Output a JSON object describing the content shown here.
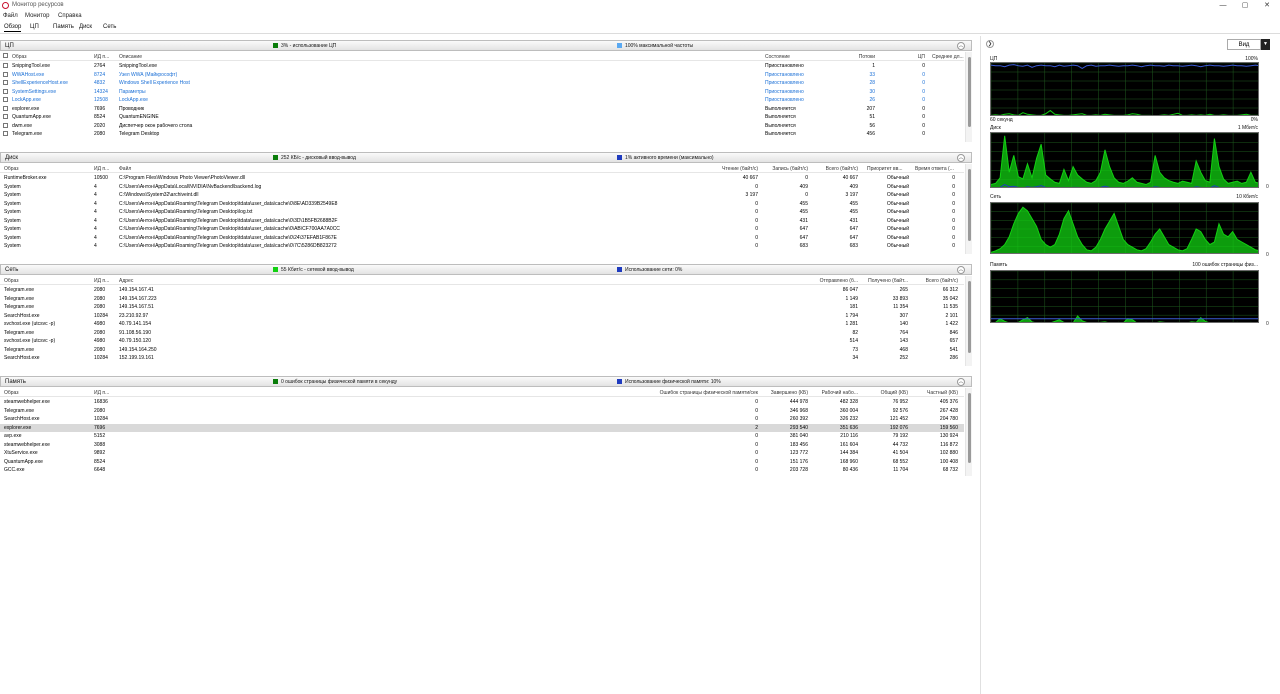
{
  "window": {
    "title": "Монитор ресурсов",
    "minimize": "—",
    "maximize": "▢",
    "close": "✕"
  },
  "menu": [
    "Файл",
    "Монитор",
    "Справка"
  ],
  "tabs": [
    "Обзор",
    "ЦП",
    "Память",
    "Диск",
    "Сеть"
  ],
  "colors": {
    "green": "#0a7d0a",
    "blue": "#1f3bbf",
    "lightblue": "#5aa9f2",
    "bright_green": "#12d012",
    "graph_bg": "#000000"
  },
  "cpu": {
    "title": "ЦП",
    "stat1": "3% - использование ЦП",
    "stat2": "100% максимальной частоты",
    "columns": [
      "Образ",
      "ИД п...",
      "Описание",
      "Состояние",
      "Потоки",
      "ЦП",
      "Среднее дл..."
    ],
    "rows": [
      {
        "image": "SnippingTool.exe",
        "pid": "2764",
        "desc": "SnippingTool.exe",
        "state": "Приостановлено",
        "threads": "1",
        "cpu": "0",
        "blue": false
      },
      {
        "image": "WWAHost.exe",
        "pid": "8724",
        "desc": "Узел WWA (Майкрософт)",
        "state": "Приостановлено",
        "threads": "33",
        "cpu": "0",
        "blue": true
      },
      {
        "image": "ShellExperienceHost.exe",
        "pid": "4832",
        "desc": "Windows Shell Experience Host",
        "state": "Приостановлено",
        "threads": "28",
        "cpu": "0",
        "blue": true
      },
      {
        "image": "SystemSettings.exe",
        "pid": "14324",
        "desc": "Параметры",
        "state": "Приостановлено",
        "threads": "30",
        "cpu": "0",
        "blue": true
      },
      {
        "image": "LockApp.exe",
        "pid": "12508",
        "desc": "LockApp.exe",
        "state": "Приостановлено",
        "threads": "26",
        "cpu": "0",
        "blue": true
      },
      {
        "image": "explorer.exe",
        "pid": "7696",
        "desc": "Проводник",
        "state": "Выполняется",
        "threads": "207",
        "cpu": "0",
        "blue": false
      },
      {
        "image": "QuantumApp.exe",
        "pid": "8524",
        "desc": "QuantumENGINE",
        "state": "Выполняется",
        "threads": "51",
        "cpu": "0",
        "blue": false
      },
      {
        "image": "dwm.exe",
        "pid": "2020",
        "desc": "Диспетчер окон рабочего стола",
        "state": "Выполняется",
        "threads": "56",
        "cpu": "0",
        "blue": false
      },
      {
        "image": "Telegram.exe",
        "pid": "2080",
        "desc": "Telegram Desktop",
        "state": "Выполняется",
        "threads": "456",
        "cpu": "0",
        "blue": false
      }
    ]
  },
  "disk": {
    "title": "Диск",
    "stat1": "252 КБ/с - дисковый ввод-вывод",
    "stat2": "1% активного времени (максимально)",
    "columns": [
      "Образ",
      "ИД п...",
      "Файл",
      "Чтение (байт/с)",
      "Запись (байт/с)",
      "Всего (байт/с)",
      "Приоритет вв...",
      "Время ответа (..."
    ],
    "rows": [
      {
        "image": "RuntimeBroker.exe",
        "pid": "10500",
        "file": "C:\\Program Files\\Windows Photo Viewer\\PhotoViewer.dll",
        "read": "40 667",
        "write": "0",
        "total": "40 667",
        "prio": "Обычный",
        "resp": "0"
      },
      {
        "image": "System",
        "pid": "4",
        "file": "C:\\Users\\Антон\\AppData\\Local\\NVIDIA\\NvBackend\\backend.log",
        "read": "0",
        "write": "409",
        "total": "409",
        "prio": "Обычный",
        "resp": "0"
      },
      {
        "image": "System",
        "pid": "4",
        "file": "C:\\Windows\\System32\\archiveint.dll",
        "read": "3 197",
        "write": "0",
        "total": "3 197",
        "prio": "Обычный",
        "resp": "0"
      },
      {
        "image": "System",
        "pid": "4",
        "file": "C:\\Users\\Антон\\AppData\\Roaming\\Telegram Desktop\\tdata\\user_data\\cache\\0\\8E\\AD339B2549E8",
        "read": "0",
        "write": "455",
        "total": "455",
        "prio": "Обычный",
        "resp": "0"
      },
      {
        "image": "System",
        "pid": "4",
        "file": "C:\\Users\\Антон\\AppData\\Roaming\\Telegram Desktop\\log.txt",
        "read": "0",
        "write": "455",
        "total": "455",
        "prio": "Обычный",
        "resp": "0"
      },
      {
        "image": "System",
        "pid": "4",
        "file": "C:\\Users\\Антон\\AppData\\Roaming\\Telegram Desktop\\tdata\\user_data\\cache\\0\\3D\\1B5FB2688B2F",
        "read": "0",
        "write": "431",
        "total": "431",
        "prio": "Обычный",
        "resp": "0"
      },
      {
        "image": "System",
        "pid": "4",
        "file": "C:\\Users\\Антон\\AppData\\Roaming\\Telegram Desktop\\tdata\\user_data\\cache\\0\\AB\\CF700AA7A0CC",
        "read": "0",
        "write": "647",
        "total": "647",
        "prio": "Обычный",
        "resp": "0"
      },
      {
        "image": "System",
        "pid": "4",
        "file": "C:\\Users\\Антон\\AppData\\Roaming\\Telegram Desktop\\tdata\\user_data\\cache\\0\\24\\37EFAB1F867E",
        "read": "0",
        "write": "647",
        "total": "647",
        "prio": "Обычный",
        "resp": "0"
      },
      {
        "image": "System",
        "pid": "4",
        "file": "C:\\Users\\Антон\\AppData\\Roaming\\Telegram Desktop\\tdata\\user_data\\cache\\0\\7C\\5286DB823272",
        "read": "0",
        "write": "683",
        "total": "683",
        "prio": "Обычный",
        "resp": "0"
      }
    ]
  },
  "net": {
    "title": "Сеть",
    "stat1": "55 Кбит/с - сетевой ввод-вывод",
    "stat2": "Использование сети: 0%",
    "columns": [
      "Образ",
      "ИД п...",
      "Адрес",
      "Отправлено (б...",
      "Получено (байт...",
      "Всего (байт/с)"
    ],
    "rows": [
      {
        "image": "Telegram.exe",
        "pid": "2080",
        "addr": "149.154.167.41",
        "sent": "86 047",
        "recv": "265",
        "total": "66 312"
      },
      {
        "image": "Telegram.exe",
        "pid": "2080",
        "addr": "149.154.167.223",
        "sent": "1 149",
        "recv": "33 893",
        "total": "35 042"
      },
      {
        "image": "Telegram.exe",
        "pid": "2080",
        "addr": "149.154.167.51",
        "sent": "181",
        "recv": "11 354",
        "total": "11 535"
      },
      {
        "image": "SearchHost.exe",
        "pid": "10284",
        "addr": "23.210.92.97",
        "sent": "1 794",
        "recv": "307",
        "total": "2 101"
      },
      {
        "image": "svchost.exe (utcsvc -p)",
        "pid": "4980",
        "addr": "40.79.141.154",
        "sent": "1 281",
        "recv": "140",
        "total": "1 422"
      },
      {
        "image": "Telegram.exe",
        "pid": "2080",
        "addr": "91.108.56.190",
        "sent": "82",
        "recv": "764",
        "total": "846"
      },
      {
        "image": "svchost.exe (utcsvc -p)",
        "pid": "4980",
        "addr": "40.79.150.120",
        "sent": "514",
        "recv": "143",
        "total": "657"
      },
      {
        "image": "Telegram.exe",
        "pid": "2080",
        "addr": "149.154.164.250",
        "sent": "73",
        "recv": "468",
        "total": "541"
      },
      {
        "image": "SearchHost.exe",
        "pid": "10284",
        "addr": "152.199.19.161",
        "sent": "34",
        "recv": "252",
        "total": "286"
      }
    ]
  },
  "memory": {
    "title": "Память",
    "stat1": "0 ошибок страницы физической памяти в секунду",
    "stat2": "Использование физической памяти: 10%",
    "columns": [
      "Образ",
      "ИД п...",
      "Ошибок страницы физической памяти/сек",
      "Завершено (КБ)",
      "Рабочий набо...",
      "Общий (КБ)",
      "Частный (КБ)"
    ],
    "rows": [
      {
        "image": "steamwebhelper.exe",
        "pid": "16836",
        "faults": "0",
        "commit": "444 978",
        "ws": "482 328",
        "shared": "76 952",
        "private": "405 376",
        "sel": false
      },
      {
        "image": "Telegram.exe",
        "pid": "2080",
        "faults": "0",
        "commit": "346 968",
        "ws": "360 004",
        "shared": "92 576",
        "private": "267 428",
        "sel": false
      },
      {
        "image": "SearchHost.exe",
        "pid": "10284",
        "faults": "0",
        "commit": "260 392",
        "ws": "326 232",
        "shared": "121 452",
        "private": "204 780",
        "sel": false
      },
      {
        "image": "explorer.exe",
        "pid": "7696",
        "faults": "2",
        "commit": "293 540",
        "ws": "351 636",
        "shared": "192 076",
        "private": "159 560",
        "sel": true
      },
      {
        "image": "avp.exe",
        "pid": "5152",
        "faults": "0",
        "commit": "381 040",
        "ws": "210 116",
        "shared": "79 192",
        "private": "130 924",
        "sel": false
      },
      {
        "image": "steamwebhelper.exe",
        "pid": "3088",
        "faults": "0",
        "commit": "183 456",
        "ws": "161 604",
        "shared": "44 732",
        "private": "116 872",
        "sel": false
      },
      {
        "image": "XtuService.exe",
        "pid": "9892",
        "faults": "0",
        "commit": "123 772",
        "ws": "144 384",
        "shared": "41 504",
        "private": "102 880",
        "sel": false
      },
      {
        "image": "QuantumApp.exe",
        "pid": "8524",
        "faults": "0",
        "commit": "151 176",
        "ws": "168 960",
        "shared": "68 552",
        "private": "100 408",
        "sel": false
      },
      {
        "image": "GCC.exe",
        "pid": "6648",
        "faults": "0",
        "commit": "203 728",
        "ws": "80 436",
        "shared": "11 704",
        "private": "68 732",
        "sel": false
      }
    ]
  },
  "right": {
    "view_label": "Вид",
    "view_dd": "▼",
    "expand": "❯",
    "cpu": {
      "label": "ЦП",
      "max": "100%",
      "time": "60 секунд",
      "min": "0%"
    },
    "disk": {
      "label": "Диск",
      "max": "1 Мбит/с",
      "min": "0"
    },
    "net": {
      "label": "Сеть",
      "max": "10 Кбит/с",
      "min": "0"
    },
    "mem": {
      "label": "Память",
      "max": "100 ошибок страницы физ...",
      "min": "0"
    }
  },
  "chart_data": [
    {
      "type": "line",
      "name": "cpu-graph",
      "ylim": [
        0,
        100
      ],
      "series": [
        {
          "name": "ЦП",
          "color": "#12d012",
          "values": [
            3,
            4,
            3,
            5,
            6,
            4,
            3,
            8,
            5,
            4,
            3,
            3,
            6,
            12,
            5,
            4,
            3,
            3,
            4,
            5,
            6,
            3,
            3,
            4,
            3,
            5,
            4,
            3,
            3,
            3,
            4,
            6,
            5,
            3,
            3,
            3,
            2,
            3,
            4,
            3,
            5,
            7,
            3,
            3,
            4,
            3,
            4,
            3,
            5,
            3,
            3,
            4,
            3,
            3,
            3,
            4,
            5,
            3,
            3,
            3
          ]
        },
        {
          "name": "Частота",
          "color": "#3b5bd6",
          "values": [
            96,
            95,
            95,
            93,
            96,
            97,
            95,
            94,
            96,
            92,
            95,
            96,
            95,
            95,
            93,
            96,
            94,
            95,
            96,
            95,
            90,
            95,
            96,
            94,
            95,
            95,
            96,
            95,
            94,
            95,
            95,
            96,
            95,
            93,
            95,
            96,
            95,
            95,
            94,
            96,
            95,
            95,
            94,
            95,
            96,
            95,
            93,
            95,
            96,
            95,
            95,
            94,
            95,
            96,
            95,
            95,
            94,
            95,
            96,
            95
          ]
        }
      ]
    },
    {
      "type": "area",
      "name": "disk-graph",
      "ylim": [
        0,
        100
      ],
      "series": [
        {
          "name": "Диск",
          "color": "#12d012",
          "values": [
            8,
            10,
            20,
            95,
            30,
            60,
            22,
            18,
            45,
            20,
            55,
            80,
            25,
            18,
            12,
            10,
            35,
            15,
            40,
            25,
            18,
            12,
            10,
            15,
            30,
            70,
            40,
            20,
            12,
            10,
            14,
            20,
            12,
            10,
            8,
            12,
            60,
            30,
            20,
            15,
            12,
            10,
            14,
            12,
            10,
            50,
            30,
            15,
            12,
            90,
            40,
            18,
            10,
            12,
            14,
            10,
            12,
            30,
            12,
            10
          ]
        },
        {
          "name": "Активность",
          "color": "#1f3bbf",
          "values": [
            2,
            2,
            3,
            8,
            4,
            5,
            3,
            2,
            4,
            3,
            4,
            6,
            3,
            2,
            2,
            2,
            3,
            2,
            3,
            3,
            2,
            2,
            2,
            2,
            3,
            5,
            3,
            2,
            2,
            2,
            2,
            3,
            2,
            2,
            2,
            2,
            4,
            3,
            2,
            2,
            2,
            2,
            2,
            2,
            2,
            4,
            3,
            2,
            2,
            6,
            3,
            2,
            2,
            2,
            2,
            2,
            2,
            3,
            2,
            2
          ]
        }
      ]
    },
    {
      "type": "area",
      "name": "net-graph",
      "ylim": [
        0,
        100
      ],
      "series": [
        {
          "name": "Сеть",
          "color": "#12d012",
          "values": [
            5,
            8,
            12,
            20,
            35,
            60,
            80,
            92,
            85,
            70,
            55,
            30,
            20,
            15,
            20,
            40,
            70,
            85,
            60,
            35,
            20,
            10,
            8,
            15,
            30,
            50,
            65,
            80,
            55,
            30,
            20,
            15,
            10,
            8,
            12,
            25,
            40,
            50,
            35,
            20,
            15,
            10,
            8,
            12,
            30,
            50,
            45,
            30,
            20,
            25,
            60,
            40,
            35,
            45,
            30,
            25,
            20,
            15,
            10,
            8
          ]
        }
      ]
    },
    {
      "type": "area",
      "name": "mem-graph",
      "ylim": [
        0,
        100
      ],
      "series": [
        {
          "name": "Ошибки страницы",
          "color": "#12d012",
          "values": [
            2,
            3,
            10,
            5,
            2,
            2,
            3,
            8,
            12,
            4,
            2,
            3,
            2,
            2,
            5,
            8,
            3,
            2,
            2,
            15,
            6,
            3,
            2,
            2,
            3,
            4,
            2,
            2,
            3,
            2,
            10,
            8,
            2,
            2,
            3,
            2,
            2,
            4,
            3,
            2,
            2,
            3,
            2,
            2,
            4,
            3,
            12,
            5,
            2,
            2,
            3,
            2,
            2,
            2,
            3,
            2,
            2,
            3,
            2,
            2
          ]
        },
        {
          "name": "Использование",
          "color": "#3b5bd6",
          "values": [
            10,
            10,
            10,
            10,
            10,
            10,
            10,
            10,
            10,
            10,
            10,
            10,
            10,
            10,
            10,
            10,
            10,
            10,
            10,
            10,
            10,
            10,
            10,
            10,
            10,
            10,
            10,
            10,
            10,
            10,
            10,
            10,
            10,
            10,
            10,
            10,
            10,
            10,
            10,
            10,
            10,
            10,
            10,
            10,
            10,
            10,
            10,
            10,
            10,
            10,
            10,
            10,
            10,
            10,
            10,
            10,
            10,
            10,
            10,
            10
          ]
        }
      ]
    }
  ]
}
